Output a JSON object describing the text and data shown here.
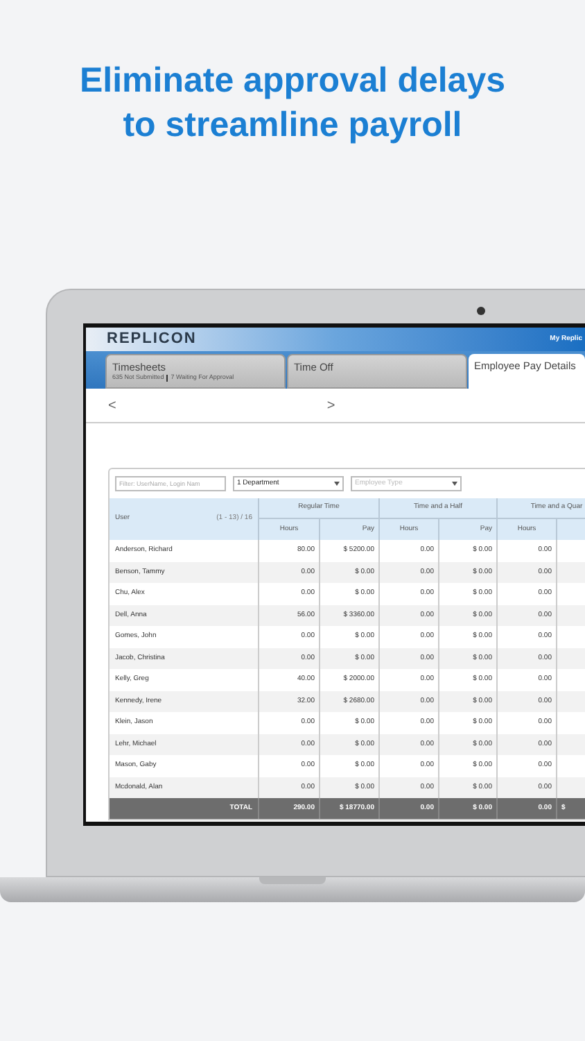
{
  "headline": [
    "Eliminate approval delays",
    "to streamline payroll"
  ],
  "app": {
    "logo": "REPLICON",
    "user_link": "My Replic",
    "tabs": [
      {
        "label": "Timesheets",
        "subtitles": [
          "635 Not Submitted",
          "7 Waiting For Approval"
        ],
        "selected": false
      },
      {
        "label": "Time Off",
        "selected": false
      },
      {
        "label": "Employee Pay Details",
        "selected": true
      }
    ],
    "nav": {
      "prev": "<",
      "next": ">"
    },
    "filters": {
      "search_placeholder": "Filter: UserName, Login Nam",
      "department": "1 Department",
      "employee_type_placeholder": "Employee Type"
    },
    "table": {
      "user_header": "User",
      "range": "(1 - 13) / 16",
      "groups": [
        "Regular Time",
        "Time and a Half",
        "Time and a Quar"
      ],
      "subcolumns": [
        "Hours",
        "Pay",
        "Hours",
        "Pay",
        "Hours"
      ],
      "rows": [
        {
          "user": "Anderson, Richard",
          "values": [
            "80.00",
            "$ 5200.00",
            "0.00",
            "$ 0.00",
            "0.00"
          ]
        },
        {
          "user": "Benson, Tammy",
          "values": [
            "0.00",
            "$ 0.00",
            "0.00",
            "$ 0.00",
            "0.00"
          ]
        },
        {
          "user": "Chu, Alex",
          "values": [
            "0.00",
            "$ 0.00",
            "0.00",
            "$ 0.00",
            "0.00"
          ]
        },
        {
          "user": "Dell, Anna",
          "values": [
            "56.00",
            "$ 3360.00",
            "0.00",
            "$ 0.00",
            "0.00"
          ]
        },
        {
          "user": "Gomes, John",
          "values": [
            "0.00",
            "$ 0.00",
            "0.00",
            "$ 0.00",
            "0.00"
          ]
        },
        {
          "user": "Jacob, Christina",
          "values": [
            "0.00",
            "$ 0.00",
            "0.00",
            "$ 0.00",
            "0.00"
          ]
        },
        {
          "user": "Kelly, Greg",
          "values": [
            "40.00",
            "$ 2000.00",
            "0.00",
            "$ 0.00",
            "0.00"
          ]
        },
        {
          "user": "Kennedy, Irene",
          "values": [
            "32.00",
            "$ 2680.00",
            "0.00",
            "$ 0.00",
            "0.00"
          ]
        },
        {
          "user": "Klein, Jason",
          "values": [
            "0.00",
            "$ 0.00",
            "0.00",
            "$ 0.00",
            "0.00"
          ]
        },
        {
          "user": "Lehr, Michael",
          "values": [
            "0.00",
            "$ 0.00",
            "0.00",
            "$ 0.00",
            "0.00"
          ]
        },
        {
          "user": "Mason, Gaby",
          "values": [
            "0.00",
            "$ 0.00",
            "0.00",
            "$ 0.00",
            "0.00"
          ]
        },
        {
          "user": "Mcdonald, Alan",
          "values": [
            "0.00",
            "$ 0.00",
            "0.00",
            "$ 0.00",
            "0.00"
          ]
        }
      ],
      "total": {
        "label": "TOTAL",
        "values": [
          "290.00",
          "$ 18770.00",
          "0.00",
          "$ 0.00",
          "0.00",
          "$"
        ]
      }
    }
  }
}
